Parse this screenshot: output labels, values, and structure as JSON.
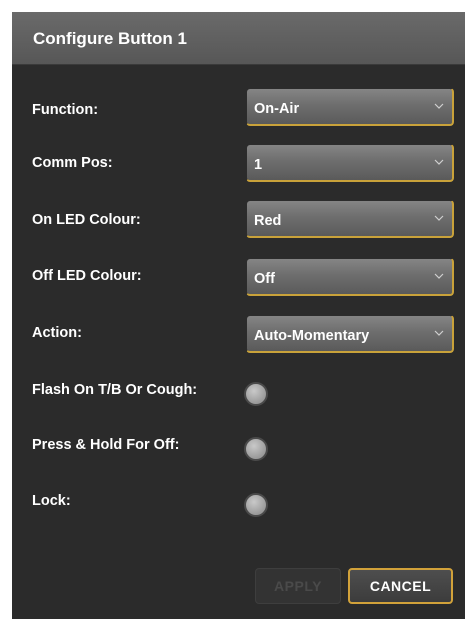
{
  "dialog": {
    "title": "Configure Button 1",
    "fields": [
      {
        "label": "Function:",
        "value": "On-Air"
      },
      {
        "label": "Comm Pos:",
        "value": "1"
      },
      {
        "label": "On LED Colour:",
        "value": "Red"
      },
      {
        "label": "Off LED Colour:",
        "value": "Off"
      },
      {
        "label": "Action:",
        "value": "Auto-Momentary"
      }
    ],
    "toggles": [
      {
        "label": "Flash On T/B Or Cough:",
        "checked": false
      },
      {
        "label": "Press & Hold For Off:",
        "checked": false
      },
      {
        "label": "Lock:",
        "checked": false
      }
    ],
    "buttons": {
      "apply": "APPLY",
      "cancel": "CANCEL"
    }
  },
  "colors": {
    "background": "#2b2b2b",
    "titlebar": "#616161",
    "accent": "#c9a23a",
    "text": "#ffffff"
  },
  "icons": {
    "dropdown": "chevron-down-icon"
  }
}
